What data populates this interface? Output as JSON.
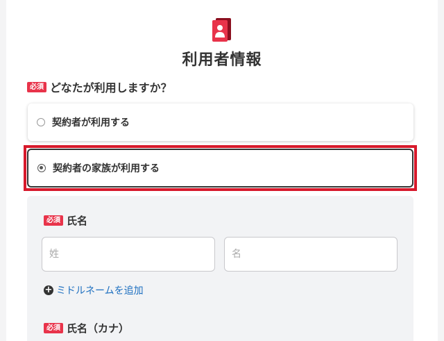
{
  "header": {
    "icon": "contact-card-icon",
    "title": "利用者情報"
  },
  "question": {
    "required_badge": "必須",
    "text": "どなたが利用しますか？"
  },
  "options": [
    {
      "label": "契約者が利用する",
      "selected": false
    },
    {
      "label": "契約者の家族が利用する",
      "selected": true
    }
  ],
  "form": {
    "name_label": "氏名",
    "name_required_badge": "必須",
    "last_name_placeholder": "姓",
    "first_name_placeholder": "名",
    "add_middle_name": "ミドルネームを追加",
    "kana_label": "氏名（カナ）",
    "kana_required_badge": "必須"
  },
  "colors": {
    "required_badge_bg": "#e8334a",
    "highlight_outline": "#d7192b",
    "link": "#1d6fc0",
    "panel_bg": "#f2f3f5"
  }
}
